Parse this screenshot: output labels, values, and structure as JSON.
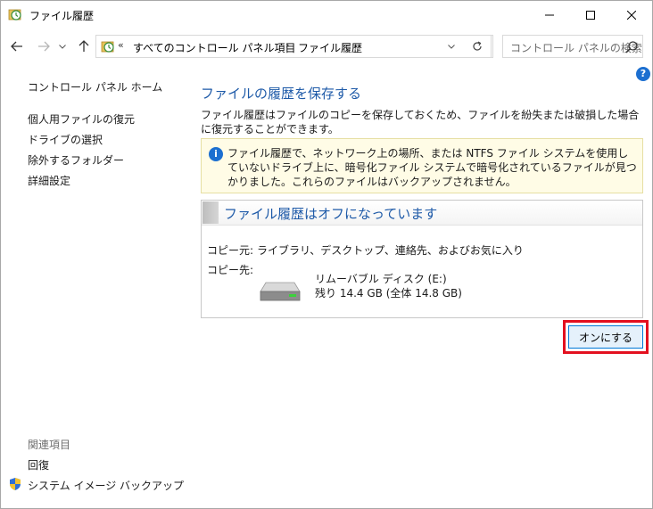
{
  "window": {
    "title": "ファイル履歴"
  },
  "address": {
    "chevron": "«",
    "crumbs": [
      "すべてのコントロール パネル項目",
      "ファイル履歴"
    ],
    "separator": "›"
  },
  "search": {
    "placeholder": "コントロール パネルの検索"
  },
  "sidebar": {
    "home": "コントロール パネル ホーム",
    "items": [
      "個人用ファイルの復元",
      "ドライブの選択",
      "除外するフォルダー",
      "詳細設定"
    ],
    "related_header": "関連項目",
    "related": [
      "回復",
      "システム イメージ バックアップ"
    ]
  },
  "main": {
    "title": "ファイルの履歴を保存する",
    "description": "ファイル履歴はファイルのコピーを保存しておくため、ファイルを紛失または破損した場合に復元することができます。",
    "info": "ファイル履歴で、ネットワーク上の場所、または NTFS ファイル システムを使用していないドライブ上に、暗号化ファイル システムで暗号化されているファイルが見つかりました。これらのファイルはバックアップされません。",
    "status": {
      "title": "ファイル履歴はオフになっています",
      "copy_from_label": "コピー元:",
      "copy_from_value": "ライブラリ、デスクトップ、連絡先、およびお気に入り",
      "copy_to_label": "コピー先:",
      "drive_name": "リムーバブル ディスク (E:)",
      "drive_space": "残り 14.4 GB (全体 14.8 GB)"
    },
    "turn_on_label": "オンにする"
  },
  "colors": {
    "link": "#1e5aa8",
    "info_bg": "#fffce6",
    "highlight": "#e3101f",
    "button_border": "#0078d7"
  }
}
